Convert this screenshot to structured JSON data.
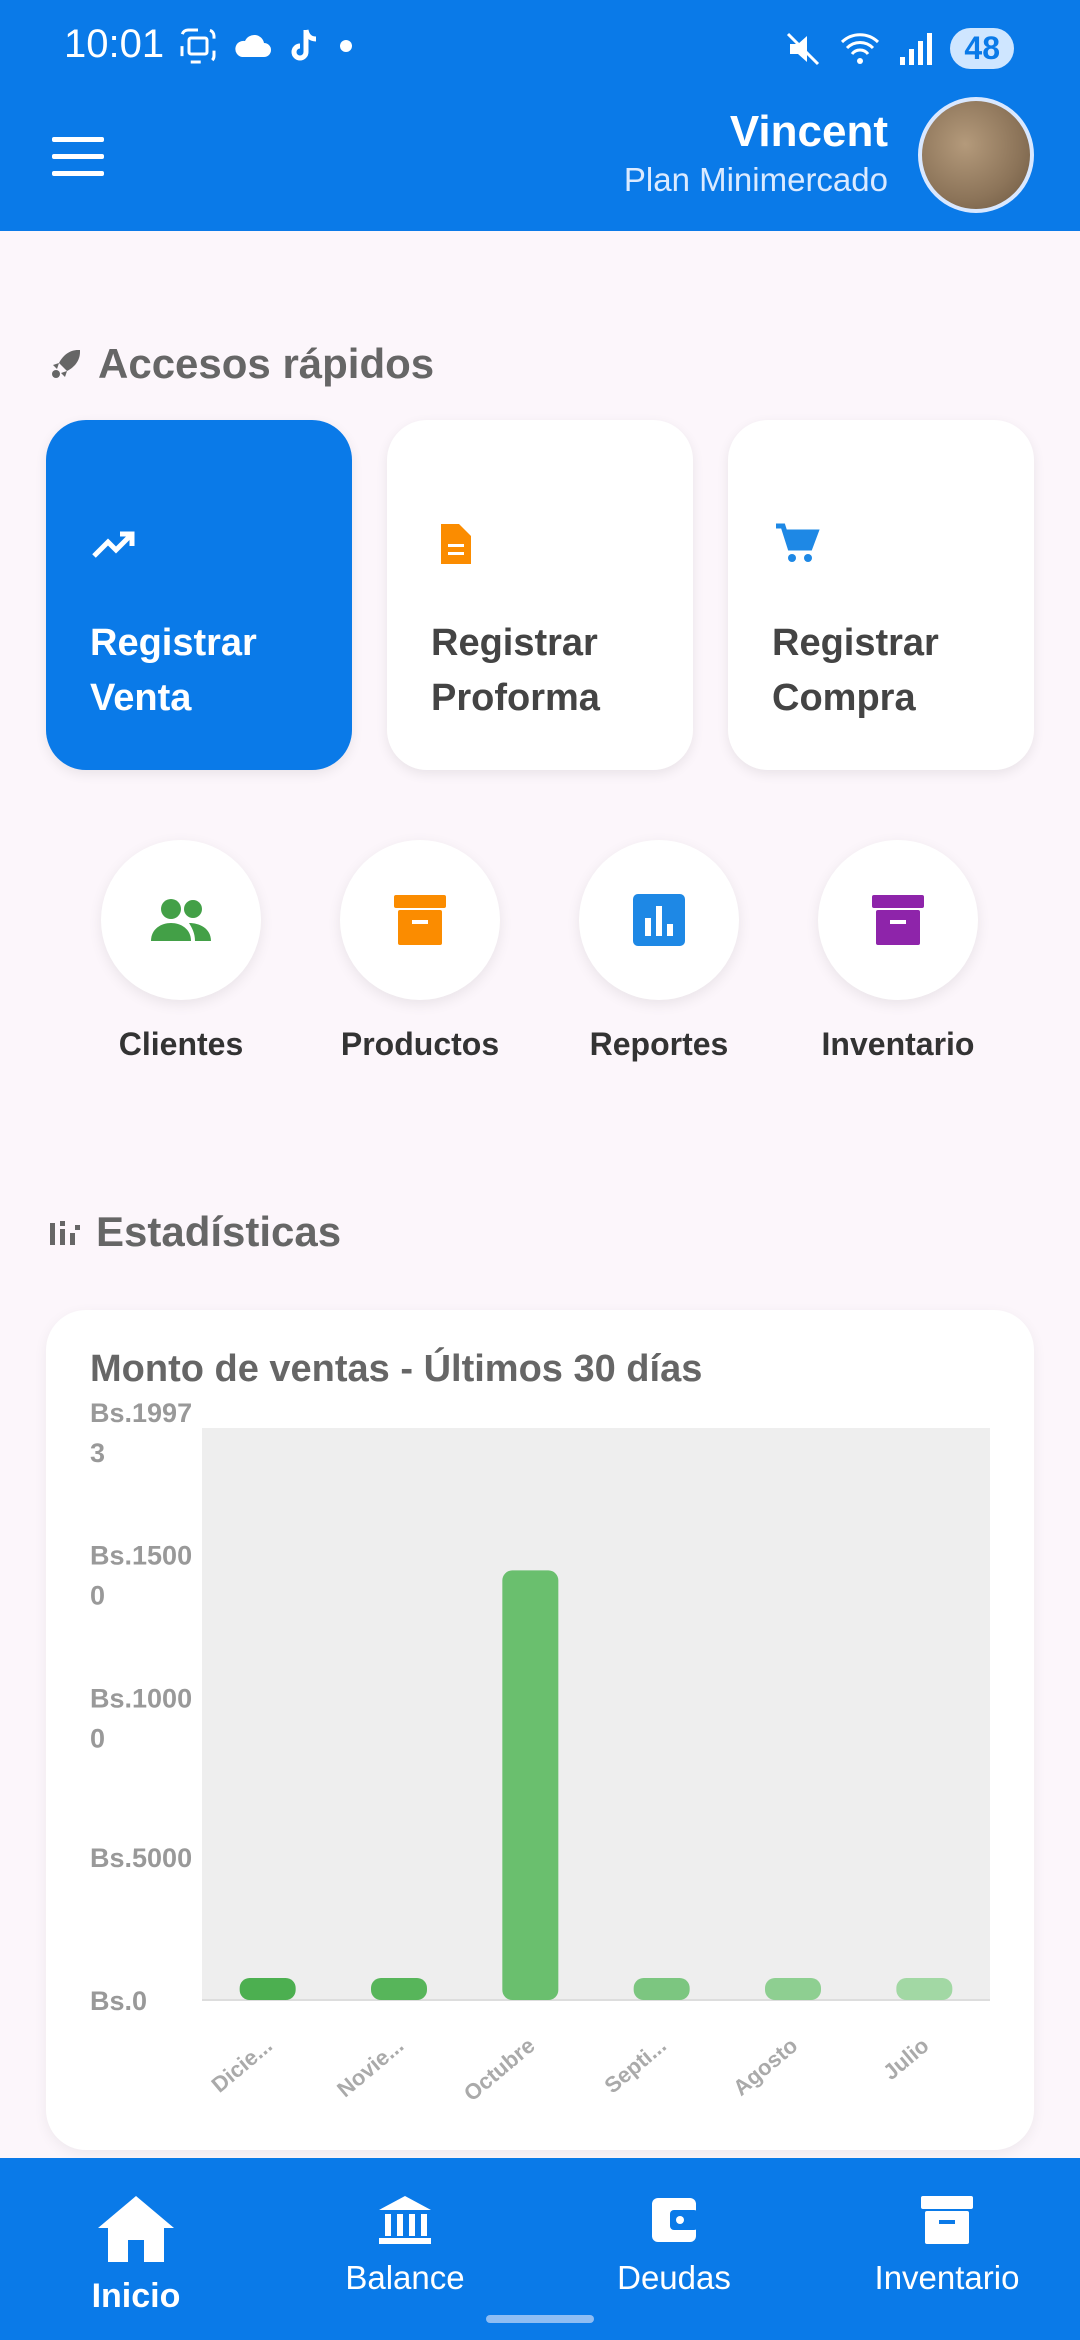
{
  "status_bar": {
    "time": "10:01",
    "battery": "48"
  },
  "header": {
    "user_name": "Vincent",
    "plan": "Plan Minimercado"
  },
  "quick_access": {
    "title": "Accesos rápidos",
    "cards": [
      {
        "line1": "Registrar",
        "line2": "Venta",
        "icon": "trending-up-icon"
      },
      {
        "line1": "Registrar",
        "line2": "Proforma",
        "icon": "document-icon"
      },
      {
        "line1": "Registrar",
        "line2": "Compra",
        "icon": "cart-icon"
      }
    ],
    "shortcuts": [
      {
        "label": "Clientes",
        "icon": "people-icon",
        "color": "#43a047"
      },
      {
        "label": "Productos",
        "icon": "archive-icon",
        "color": "#fb8c00"
      },
      {
        "label": "Reportes",
        "icon": "bar-chart-icon",
        "color": "#1e88e5"
      },
      {
        "label": "Inventario",
        "icon": "archive-icon",
        "color": "#8e24aa"
      }
    ]
  },
  "stats": {
    "title": "Estadísticas"
  },
  "chart_data": {
    "type": "bar",
    "title": "Monto de ventas - Últimos 30 días",
    "categories": [
      "Dicie...",
      "Novie...",
      "Octubre",
      "Septi...",
      "Agosto",
      "Julio"
    ],
    "values": [
      0,
      0,
      15000,
      0,
      0,
      0
    ],
    "y_tick_labels": [
      "Bs.0",
      "Bs.5000",
      "Bs.10000",
      "Bs.15000",
      "Bs.19973"
    ],
    "y_ticks": [
      0,
      5000,
      10000,
      15000,
      19973
    ],
    "ylim": [
      0,
      19973
    ],
    "bar_colors": [
      "#4caf50",
      "#57b55a",
      "#6abf6e",
      "#7cc680",
      "#8ecf91",
      "#a2d8a4"
    ],
    "grid": false
  },
  "bottom_nav": {
    "items": [
      {
        "label": "Inicio",
        "icon": "home-icon"
      },
      {
        "label": "Balance",
        "icon": "bank-icon"
      },
      {
        "label": "Deudas",
        "icon": "wallet-icon"
      },
      {
        "label": "Inventario",
        "icon": "archive-icon"
      }
    ]
  }
}
